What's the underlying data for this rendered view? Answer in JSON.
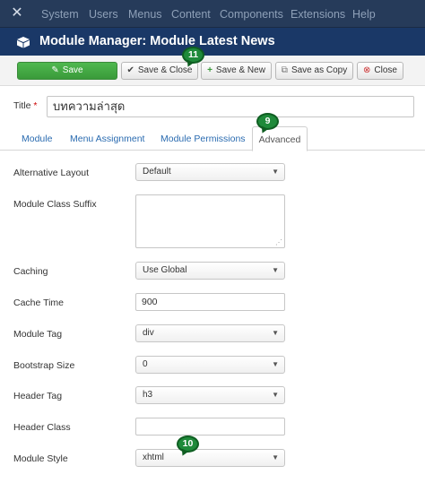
{
  "topnav": {
    "logo_icon": "joomla-icon",
    "items": [
      "System",
      "Users",
      "Menus",
      "Content",
      "Components",
      "Extensions",
      "Help"
    ]
  },
  "header": {
    "icon": "cube-icon",
    "title": "Module Manager: Module Latest News"
  },
  "toolbar": {
    "save": "Save",
    "save_close": "Save & Close",
    "save_new": "Save & New",
    "save_copy": "Save as Copy",
    "close": "Close"
  },
  "form": {
    "title_label": "Title",
    "title_required": "*",
    "title_value": "บทความล่าสุด"
  },
  "tabs": [
    "Module",
    "Menu Assignment",
    "Module Permissions",
    "Advanced"
  ],
  "fields": {
    "alt_layout_label": "Alternative Layout",
    "alt_layout_value": "Default",
    "class_suffix_label": "Module Class Suffix",
    "caching_label": "Caching",
    "caching_value": "Use Global",
    "cache_time_label": "Cache Time",
    "cache_time_value": "900",
    "module_tag_label": "Module Tag",
    "module_tag_value": "div",
    "bootstrap_label": "Bootstrap Size",
    "bootstrap_value": "0",
    "header_tag_label": "Header Tag",
    "header_tag_value": "h3",
    "header_class_label": "Header Class",
    "module_style_label": "Module Style",
    "module_style_value": "xhtml"
  },
  "annotations": [
    "11",
    "9",
    "10"
  ],
  "colors": {
    "topnav_bg": "#263b5a",
    "titlebar_bg": "#1a3867",
    "save_button": "#46a546",
    "badge": "#1f8a3a",
    "link": "#2a6bb0"
  }
}
